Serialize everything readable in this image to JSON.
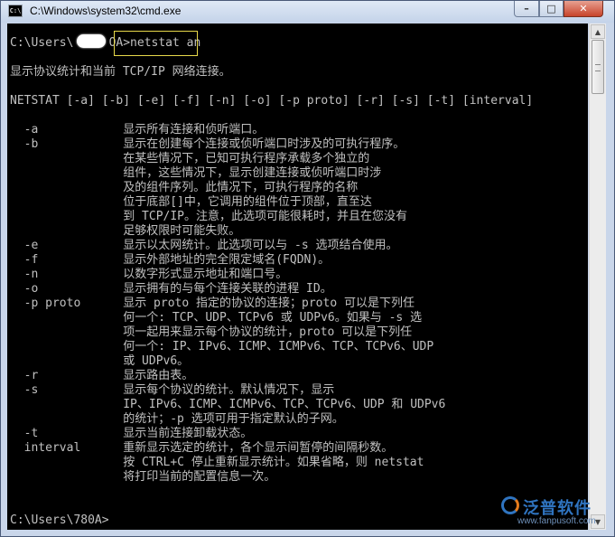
{
  "window": {
    "title": "C:\\Windows\\system32\\cmd.exe",
    "icon_label": "C:\\",
    "controls": {
      "minimize": "–",
      "maximize": "□",
      "close": "✕"
    }
  },
  "console": {
    "lines": [
      "C:\\Users\\     OA>netstat an",
      "",
      "显示协议统计和当前 TCP/IP 网络连接。",
      "",
      "NETSTAT [-a] [-b] [-e] [-f] [-n] [-o] [-p proto] [-r] [-s] [-t] [interval]",
      "",
      "  -a            显示所有连接和侦听端口。",
      "  -b            显示在创建每个连接或侦听端口时涉及的可执行程序。",
      "                在某些情况下，已知可执行程序承载多个独立的",
      "                组件，这些情况下，显示创建连接或侦听端口时涉",
      "                及的组件序列。此情况下，可执行程序的名称",
      "                位于底部[]中，它调用的组件位于顶部，直至达",
      "                到 TCP/IP。注意，此选项可能很耗时，并且在您没有",
      "                足够权限时可能失败。",
      "  -e            显示以太网统计。此选项可以与 -s 选项结合使用。",
      "  -f            显示外部地址的完全限定域名(FQDN)。",
      "  -n            以数字形式显示地址和端口号。",
      "  -o            显示拥有的与每个连接关联的进程 ID。",
      "  -p proto      显示 proto 指定的协议的连接；proto 可以是下列任",
      "                何一个: TCP、UDP、TCPv6 或 UDPv6。如果与 -s 选",
      "                项一起用来显示每个协议的统计，proto 可以是下列任",
      "                何一个: IP、IPv6、ICMP、ICMPv6、TCP、TCPv6、UDP",
      "                或 UDPv6。",
      "  -r            显示路由表。",
      "  -s            显示每个协议的统计。默认情况下，显示",
      "                IP、IPv6、ICMP、ICMPv6、TCP、TCPv6、UDP 和 UDPv6",
      "                的统计；-p 选项可用于指定默认的子网。",
      "  -t            显示当前连接卸载状态。",
      "  interval      重新显示选定的统计，各个显示间暂停的间隔秒数。",
      "                按 CTRL+C 停止重新显示统计。如果省略，则 netstat",
      "                将打印当前的配置信息一次。",
      "",
      "",
      "C:\\Users\\780A>"
    ]
  },
  "watermark": {
    "brand": "泛普软件",
    "url": "www.fanpusoft.com"
  },
  "scrollbar": {
    "up": "▲",
    "down": "▼"
  },
  "colors": {
    "console_bg": "#000000",
    "console_text": "#c0c0c0",
    "highlight": "#e8d94a"
  }
}
